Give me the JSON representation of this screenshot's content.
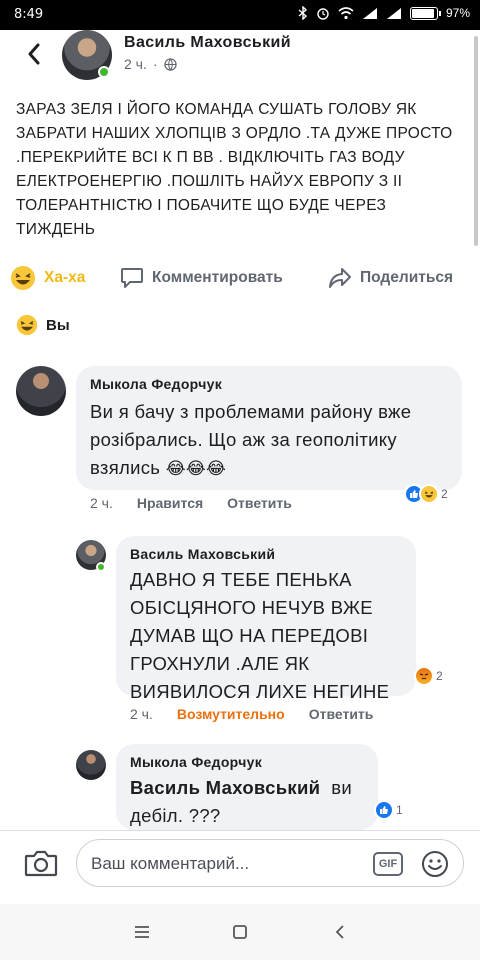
{
  "status_bar": {
    "time": "8:49",
    "battery": "97%",
    "battery_level": 0.97
  },
  "post": {
    "author": "Василь Маховський",
    "time": "2 ч.",
    "text": "ЗАРАЗ ЗЕЛЯ І ЙОГО КОМАНДА СУШАТЬ ГОЛОВУ ЯК ЗАБРАТИ НАШИХ ХЛОПЦІВ З ОРДЛО .ТА ДУЖЕ ПРОСТО .ПЕРЕКРИЙТЕ ВСІ К П ВВ . ВІДКЛЮЧІТЬ ГАЗ ВОДУ ЕЛЕКТРОЕНЕРГІЮ .ПОШЛІТЬ НАЙУХ ЕВРОПУ З ІІ ТОЛЕРАНТНІСТЮ І ПОБАЧИТЕ ЩО БУДЕ ЧЕРЕЗ ТИЖДЕНЬ"
  },
  "actions": {
    "haha": "Ха-ха",
    "comment": "Комментировать",
    "share": "Поделиться"
  },
  "reactions_summary": {
    "label": "Вы"
  },
  "comments": [
    {
      "author": "Мыкола Федорчук",
      "text": "Ви я бачу з проблемами району вже розібрались. Що аж за геополітику взялись",
      "emoji_tail": "😂😂😂",
      "time": "2 ч.",
      "reaction_label": "Нравится",
      "reply_label": "Ответить",
      "reaction_count": "2"
    },
    {
      "author": "Василь Маховський",
      "text": "ДАВНО Я ТЕБЕ ПЕНЬКА ОБІСЦЯНОГО НЕЧУВ ВЖЕ ДУМАВ ЩО НА ПЕРЕДОВІ ГРОХНУЛИ .АЛЕ ЯК ВИЯВИЛОСЯ ЛИХЕ НЕГИНЕ",
      "time": "2 ч.",
      "reaction_label": "Возмутительно",
      "reply_label": "Ответить",
      "reaction_count": "2"
    },
    {
      "author": "Мыкола Федорчук",
      "mention": "Василь Маховський",
      "text": "ви дебіл. ???",
      "reaction_count": "1"
    }
  ],
  "composer": {
    "placeholder": "Ваш комментарий...",
    "gif_label": "GIF"
  },
  "icons": {
    "back": "back-arrow-icon",
    "globe": "globe-icon",
    "camera": "camera-icon",
    "smile": "smile-icon"
  }
}
